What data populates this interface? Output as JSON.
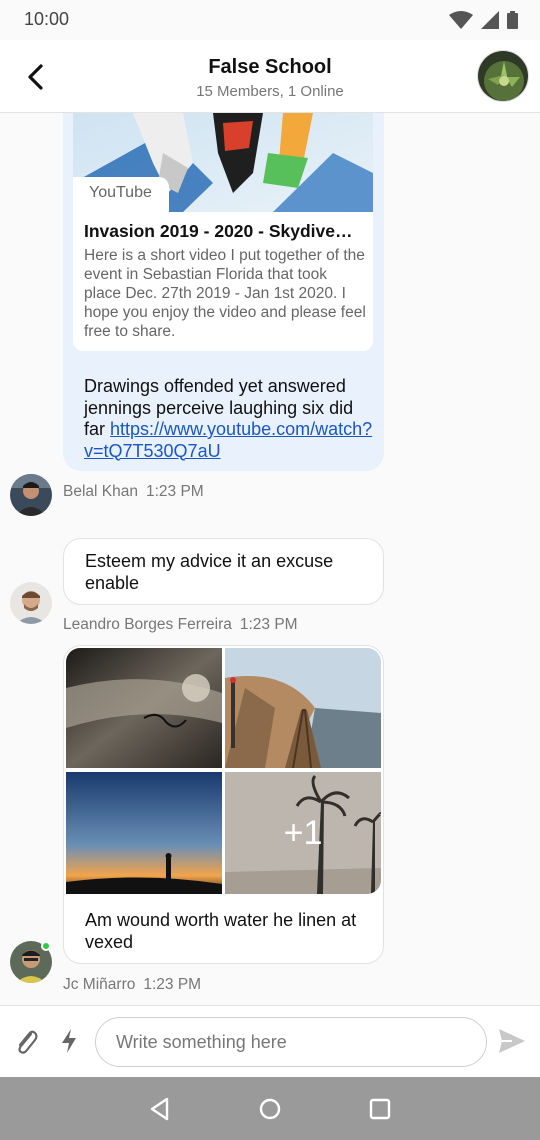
{
  "status_bar": {
    "time": "10:00"
  },
  "header": {
    "back_icon": "arrow-left-icon",
    "title": "False School",
    "subtitle": "15 Members, 1 Online"
  },
  "messages": [
    {
      "type": "link",
      "link_preview": {
        "source": "YouTube",
        "title": "Invasion 2019 - 2020 - Skydive…",
        "description": "Here is a short video I put together of the event in Sebastian Florida that took place Dec. 27th 2019 - Jan 1st 2020. I hope you enjoy the video and please feel free to share."
      },
      "text": "Drawings offended yet answered jennings perceive laughing six did far ",
      "link": "https://www.youtube.com/watch?v=tQ7T530Q7aU",
      "sender": "Belal Khan",
      "time": "1:23 PM"
    },
    {
      "type": "text",
      "text": "Esteem my advice it an excuse enable",
      "sender": "Leandro Borges Ferreira",
      "time": "1:23 PM"
    },
    {
      "type": "images",
      "more_count": "+1",
      "text": "Am wound worth water he linen at vexed",
      "sender": "Jc Miñarro",
      "time": "1:23 PM",
      "sender_online": true
    }
  ],
  "composer": {
    "placeholder": "Write something here",
    "attach_icon": "paperclip-icon",
    "action_icon": "lightning-icon",
    "send_icon": "send-icon"
  },
  "colors": {
    "own_bubble": "#e8f1fc",
    "link": "#1a56c8",
    "online": "#2ecc40",
    "nav_bar": "#9a9a9a"
  }
}
